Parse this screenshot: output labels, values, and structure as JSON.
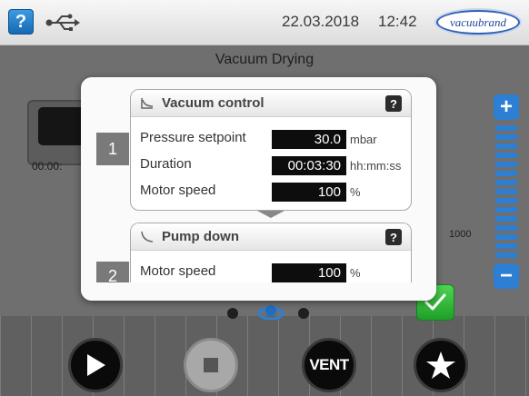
{
  "header": {
    "help_label": "?",
    "date": "22.03.2018",
    "time": "12:42",
    "brand": "vacuubrand",
    "usb_icon": "usb-icon"
  },
  "screen": {
    "title": "Vacuum Drying",
    "background_time": "00:00:",
    "background_scale_value": "1000",
    "scale_plus": "+",
    "scale_minus": "−"
  },
  "dialog": {
    "steps": [
      {
        "number": "1",
        "title": "Vacuum control",
        "help": "?",
        "rows": [
          {
            "label": "Pressure setpoint",
            "value": "30.0",
            "unit": "mbar"
          },
          {
            "label": "Duration",
            "value": "00:03:30",
            "unit": "hh:mm:ss"
          },
          {
            "label": "Motor speed",
            "value": "100",
            "unit": "%"
          }
        ]
      },
      {
        "number": "2",
        "title": "Pump down",
        "help": "?",
        "rows": [
          {
            "label": "Motor speed",
            "value": "100",
            "unit": "%"
          }
        ]
      }
    ]
  },
  "controls": {
    "vent_label": "VENT",
    "play_icon": "play-icon",
    "stop_icon": "stop-icon",
    "favorite_icon": "star-icon",
    "confirm_icon": "checkmark-icon"
  },
  "colors": {
    "accent_blue": "#2c7fd2",
    "confirm_green": "#2fb83a",
    "value_field": "#0d0d0d"
  }
}
